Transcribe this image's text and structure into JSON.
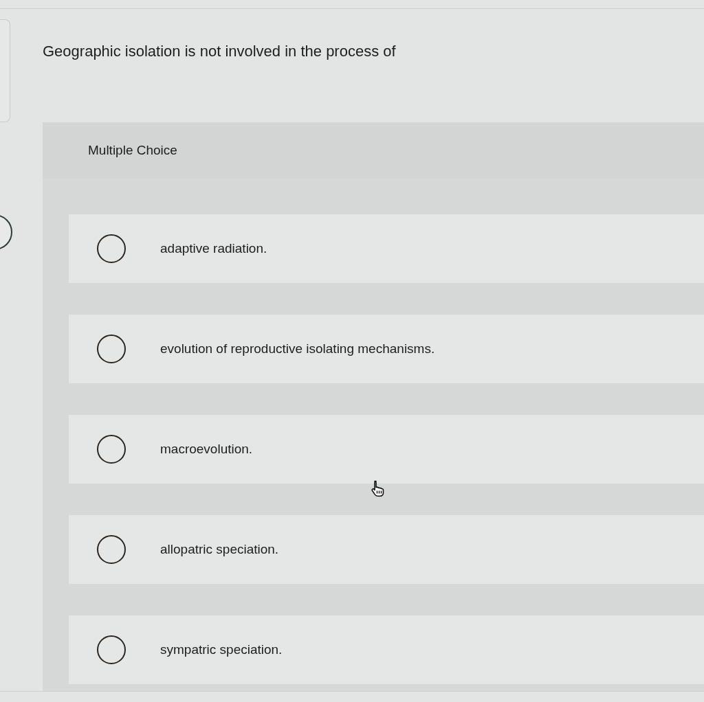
{
  "question": {
    "text": "Geographic isolation is not involved in the process of"
  },
  "choices": {
    "heading": "Multiple Choice",
    "options": [
      {
        "label": "adaptive radiation.",
        "selected": false
      },
      {
        "label": "evolution of reproductive isolating mechanisms.",
        "selected": false
      },
      {
        "label": "macroevolution.",
        "selected": false
      },
      {
        "label": "allopatric speciation.",
        "selected": false
      },
      {
        "label": "sympatric speciation.",
        "selected": false
      }
    ]
  }
}
